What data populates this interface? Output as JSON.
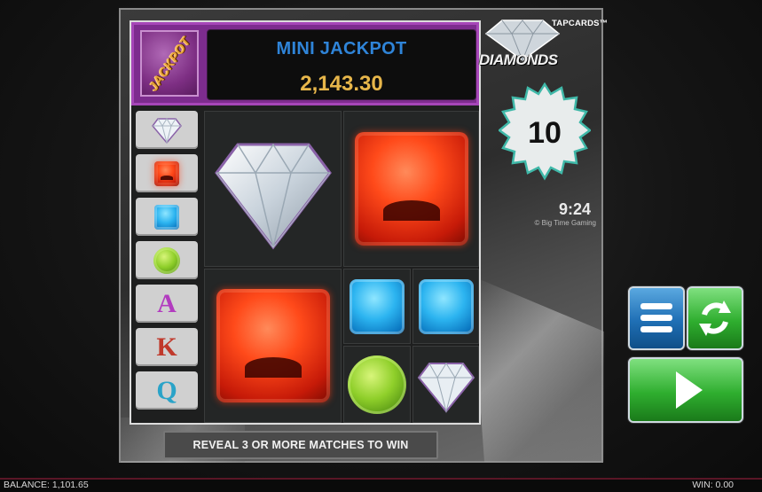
{
  "jackpot": {
    "badge_label": "JACKPOT",
    "title": "MINI JACKPOT",
    "value": "2,143.30"
  },
  "brand": {
    "logo_text": "DIAMONDS",
    "tapcards_label": "TAPCARDS™",
    "credit": "© Big Time Gaming"
  },
  "badge": {
    "count": "10"
  },
  "clock": {
    "time": "9:24"
  },
  "paytable": {
    "items": [
      {
        "icon": "diamond-icon"
      },
      {
        "icon": "ruby-icon"
      },
      {
        "icon": "sapphire-icon"
      },
      {
        "icon": "emerald-icon"
      },
      {
        "letter": "A",
        "color": "#b23bbf"
      },
      {
        "letter": "K",
        "color": "#c0392b"
      },
      {
        "letter": "Q",
        "color": "#2aa3c8"
      }
    ]
  },
  "board": {
    "cells": [
      "diamond",
      "ruby",
      "ruby",
      "sapphire",
      "sapphire",
      "emerald",
      "diamond"
    ]
  },
  "reveal_text": "REVEAL 3 OR MORE MATCHES TO WIN",
  "footer": {
    "balance": "BALANCE: 1,101.65",
    "win": "WIN: 0.00"
  },
  "colors": {
    "jackpot_panel": "#7d2c8e",
    "jackpot_title": "#2f84d8",
    "jackpot_value": "#e7b64a",
    "menu_button": "#1f6fb5",
    "spin_button": "#2fae2f"
  }
}
